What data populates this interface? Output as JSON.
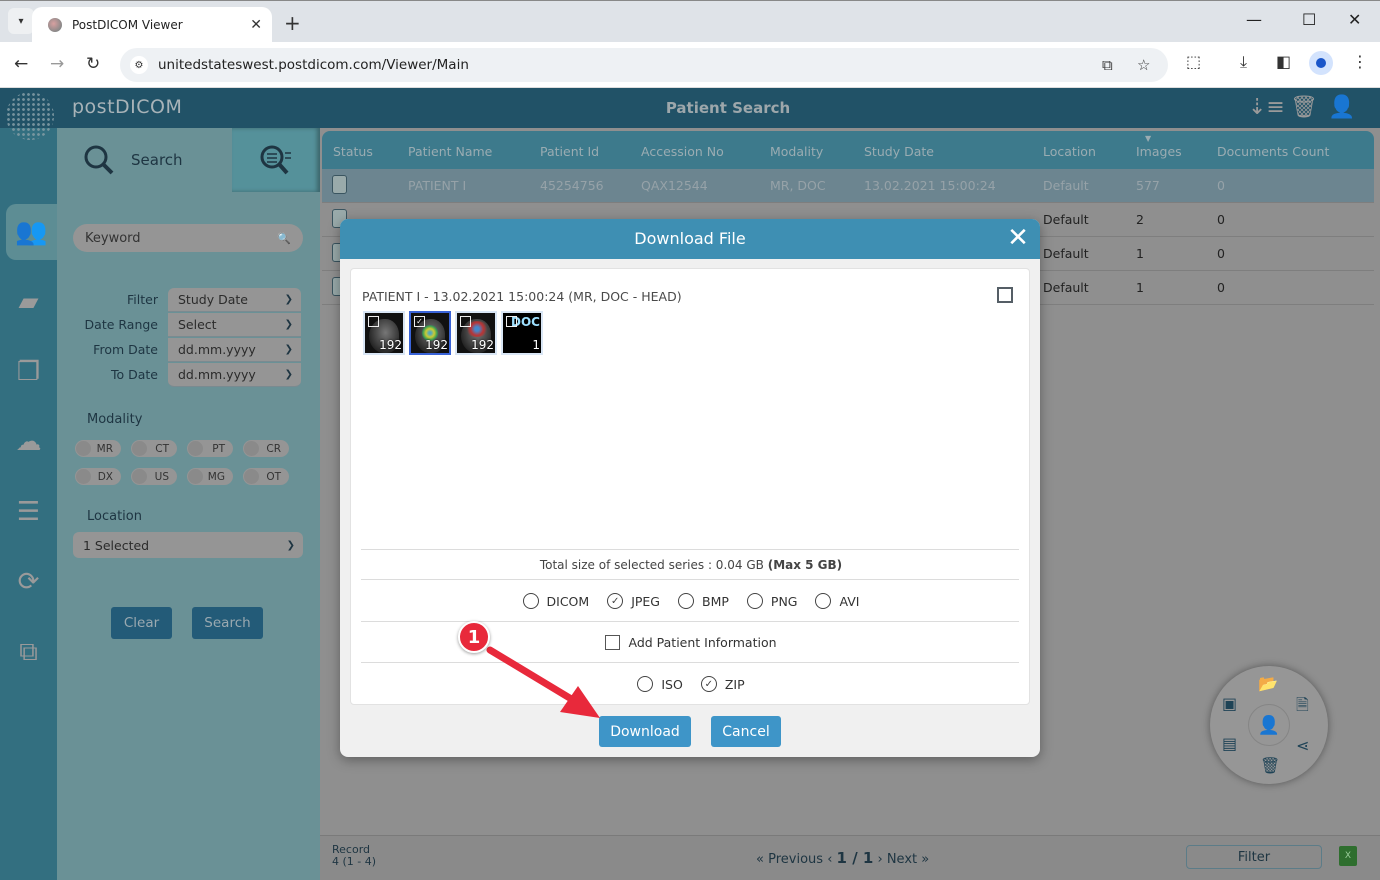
{
  "browser": {
    "tab_title": "PostDICOM Viewer",
    "url": "unitedstateswest.postdicom.com/Viewer/Main"
  },
  "app": {
    "brand": "postDICOM",
    "page_title": "Patient Search"
  },
  "side_panel": {
    "search_tab": "Search",
    "keyword_placeholder": "Keyword",
    "filters": [
      {
        "label": "Filter",
        "value": "Study Date"
      },
      {
        "label": "Date Range",
        "value": "Select"
      },
      {
        "label": "From Date",
        "value": "dd.mm.yyyy"
      },
      {
        "label": "To Date",
        "value": "dd.mm.yyyy"
      }
    ],
    "modality_label": "Modality",
    "modalities": [
      "MR",
      "CT",
      "PT",
      "CR",
      "DX",
      "US",
      "MG",
      "OT"
    ],
    "location_label": "Location",
    "location_value": "1 Selected",
    "clear_label": "Clear",
    "search_label": "Search"
  },
  "table": {
    "columns": [
      "Status",
      "Patient Name",
      "Patient Id",
      "Accession No",
      "Modality",
      "Study Date",
      "Location",
      "Images",
      "Documents Count"
    ],
    "rows": [
      {
        "name": "PATIENT I",
        "id": "45254756",
        "accession": "QAX12544",
        "modality": "MR, DOC",
        "date": "13.02.2021 15:00:24",
        "location": "Default",
        "images": "577",
        "docs": "0"
      },
      {
        "name": "",
        "id": "",
        "accession": "",
        "modality": "",
        "date": "",
        "location": "Default",
        "images": "2",
        "docs": "0"
      },
      {
        "name": "",
        "id": "",
        "accession": "",
        "modality": "",
        "date": "",
        "location": "Default",
        "images": "1",
        "docs": "0"
      },
      {
        "name": "",
        "id": "",
        "accession": "",
        "modality": "",
        "date": "",
        "location": "Default",
        "images": "1",
        "docs": "0"
      }
    ]
  },
  "footer": {
    "record_label": "Record",
    "record_value": "4 (1 - 4)",
    "previous": "Previous",
    "page": "1 / 1",
    "next": "Next",
    "filter_label": "Filter"
  },
  "modal": {
    "title": "Download File",
    "study_title": "PATIENT I - 13.02.2021 15:00:24 (MR, DOC - HEAD)",
    "series": [
      {
        "count": "192",
        "checked": false,
        "type": "mr"
      },
      {
        "count": "192",
        "checked": true,
        "type": "mr-seg1"
      },
      {
        "count": "192",
        "checked": false,
        "type": "mr-seg2"
      },
      {
        "count": "1",
        "checked": false,
        "type": "doc",
        "label": "DOC"
      }
    ],
    "size_text": "Total size of selected series : 0.04 GB",
    "size_max": "(Max 5 GB)",
    "formats": [
      {
        "label": "DICOM",
        "selected": false
      },
      {
        "label": "JPEG",
        "selected": true
      },
      {
        "label": "BMP",
        "selected": false
      },
      {
        "label": "PNG",
        "selected": false
      },
      {
        "label": "AVI",
        "selected": false
      }
    ],
    "add_patient_info": "Add Patient Information",
    "packages": [
      {
        "label": "ISO",
        "selected": false
      },
      {
        "label": "ZIP",
        "selected": true
      }
    ],
    "download_label": "Download",
    "cancel_label": "Cancel"
  },
  "annotation": {
    "step": "1",
    "color": "#e8293b"
  }
}
